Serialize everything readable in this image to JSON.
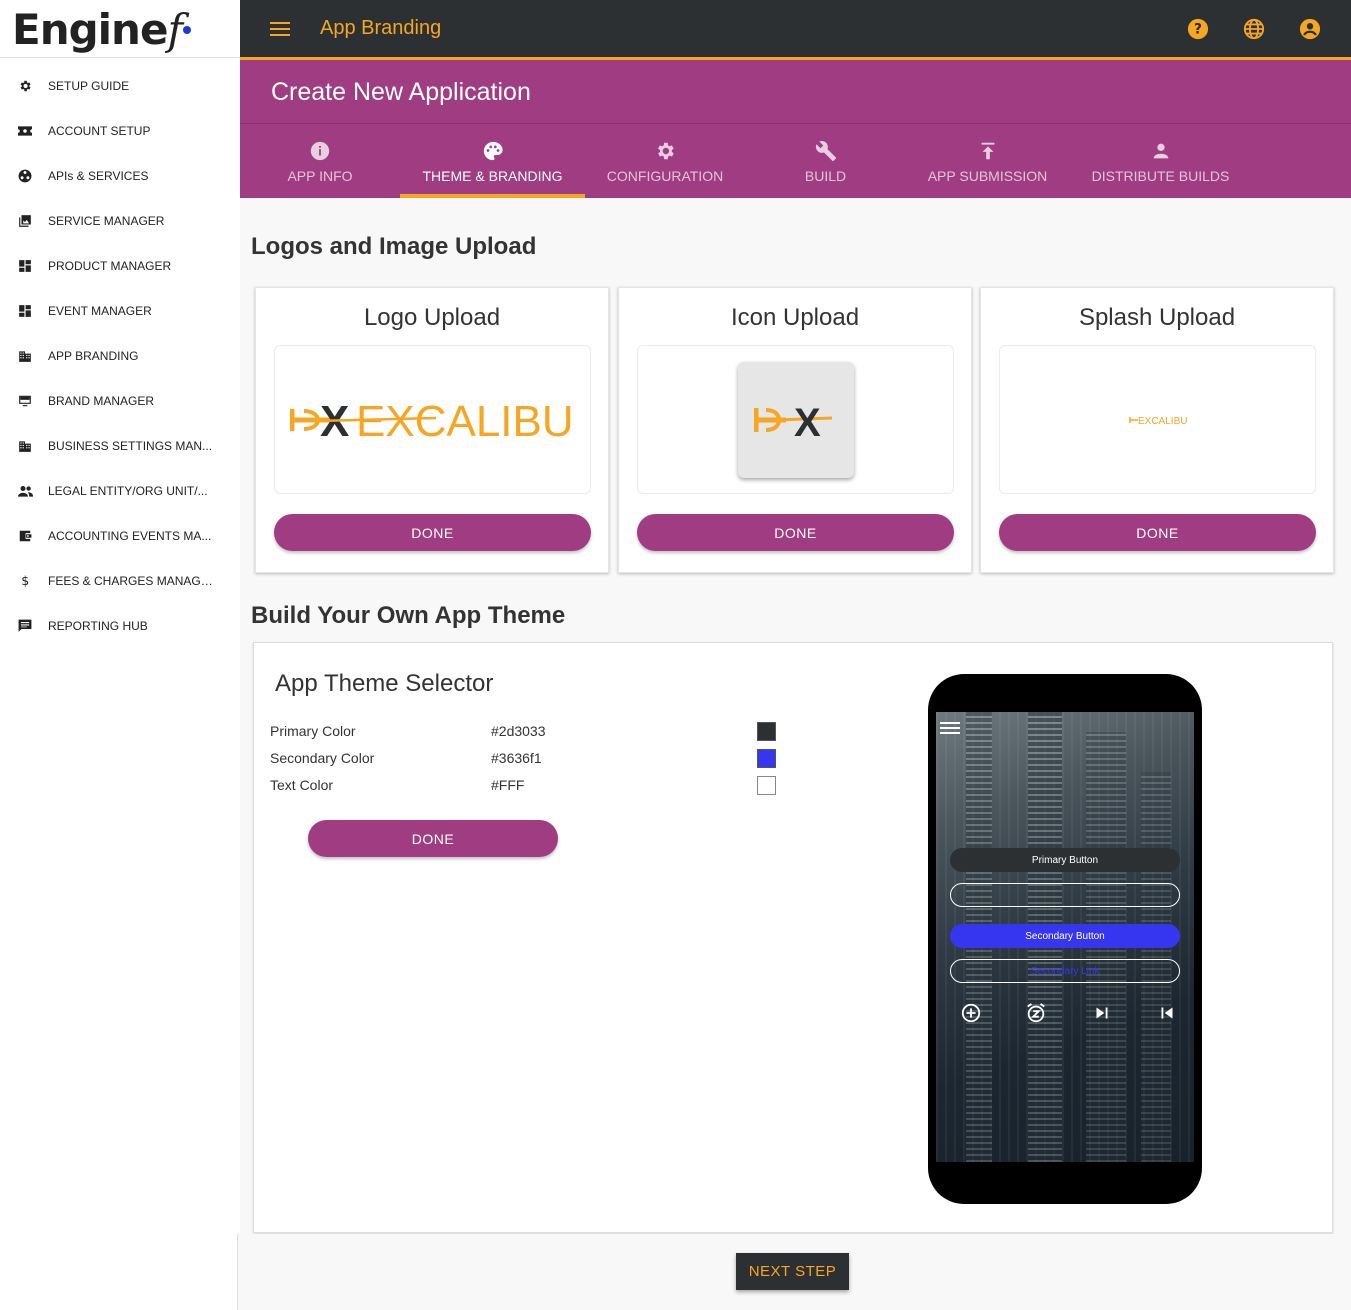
{
  "brand": {
    "name": "Engine",
    "suffix": "f"
  },
  "sidebar": {
    "items": [
      {
        "label": "SETUP GUIDE",
        "icon": "gear-icon"
      },
      {
        "label": "ACCOUNT SETUP",
        "icon": "ticket-icon"
      },
      {
        "label": "APIs & SERVICES",
        "icon": "api-icon"
      },
      {
        "label": "SERVICE MANAGER",
        "icon": "library-icon"
      },
      {
        "label": "PRODUCT MANAGER",
        "icon": "dashboard-icon"
      },
      {
        "label": "EVENT MANAGER",
        "icon": "dashboard-icon"
      },
      {
        "label": "APP BRANDING",
        "icon": "building-icon"
      },
      {
        "label": "BRAND MANAGER",
        "icon": "monitor-icon"
      },
      {
        "label": "BUSINESS SETTINGS MAN...",
        "icon": "building-icon"
      },
      {
        "label": "LEGAL ENTITY/ORG UNIT/...",
        "icon": "people-icon"
      },
      {
        "label": "ACCOUNTING EVENTS MA...",
        "icon": "wallet-icon"
      },
      {
        "label": "FEES & CHARGES MANAGER",
        "icon": "dollar-icon"
      },
      {
        "label": "REPORTING HUB",
        "icon": "message-icon"
      }
    ]
  },
  "topbar": {
    "title": "App Branding",
    "icons": [
      "help-icon",
      "globe-icon",
      "account-icon"
    ]
  },
  "header": {
    "title": "Create New Application",
    "tabs": [
      {
        "label": "APP INFO",
        "icon": "info-icon"
      },
      {
        "label": "THEME & BRANDING",
        "icon": "palette-icon",
        "active": true
      },
      {
        "label": "CONFIGURATION",
        "icon": "gear-icon"
      },
      {
        "label": "BUILD",
        "icon": "wrench-icon"
      },
      {
        "label": "APP SUBMISSION",
        "icon": "upload-icon"
      },
      {
        "label": "DISTRIBUTE BUILDS",
        "icon": "person-icon"
      }
    ]
  },
  "logos_section": {
    "title": "Logos and Image Upload",
    "cards": [
      {
        "title": "Logo Upload",
        "button": "DONE",
        "logo_text": "EXCALIBUR"
      },
      {
        "title": "Icon Upload",
        "button": "DONE",
        "logo_text": "EX"
      },
      {
        "title": "Splash Upload",
        "button": "DONE",
        "logo_text": "EXCALIBUR"
      }
    ]
  },
  "theme_section": {
    "title": "Build Your Own App Theme",
    "selector_title": "App Theme Selector",
    "colors": [
      {
        "name": "Primary Color",
        "value": "#2d3033"
      },
      {
        "name": "Secondary Color",
        "value": "#3636f1"
      },
      {
        "name": "Text Color",
        "value": "#FFF"
      }
    ],
    "done_button": "DONE"
  },
  "phone_preview": {
    "primary_button": "Primary Button",
    "secondary_button": "Secondary Button",
    "secondary_link": "Secondary Link",
    "icons": [
      "add-circle-icon",
      "snooze-icon",
      "skip-next-icon",
      "skip-previous-icon"
    ]
  },
  "footer": {
    "next_button": "NEXT STEP"
  },
  "colors": {
    "accent": "#f5a623",
    "brand_purple": "#a03c82",
    "primary": "#2d3033",
    "secondary": "#3636f1"
  }
}
